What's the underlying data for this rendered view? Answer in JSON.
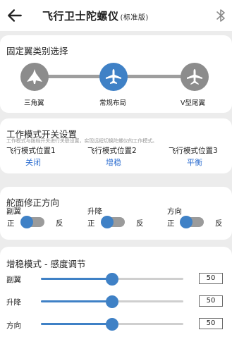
{
  "header": {
    "title": "飞行卫士陀螺仪",
    "subtitle": "(标准版)",
    "back_icon": "arrow-left-icon",
    "bluetooth_icon": "bluetooth-icon"
  },
  "wing_type": {
    "title": "固定翼类别选择",
    "options": [
      {
        "label": "三角翼",
        "icon": "delta-wing-plane-icon"
      },
      {
        "label": "常规布局",
        "icon": "conventional-plane-icon"
      },
      {
        "label": "V型尾翼",
        "icon": "v-tail-plane-icon"
      }
    ],
    "selected_index": 1
  },
  "work_mode": {
    "title": "工作模式开关设置",
    "hint": "工作模式与拨档开关进行关联设置，实现远程切换陀螺仪的工作模式。",
    "positions": [
      {
        "label": "飞行模式位置1",
        "value": "关闭"
      },
      {
        "label": "飞行模式位置2",
        "value": "增稳"
      },
      {
        "label": "飞行模式位置3",
        "value": "平衡"
      }
    ]
  },
  "servo_direction": {
    "title": "舵面修正方向",
    "forward_label": "正",
    "reverse_label": "反",
    "axes": [
      {
        "label": "副翼",
        "reversed": false
      },
      {
        "label": "升降",
        "reversed": false
      },
      {
        "label": "方向",
        "reversed": false
      }
    ]
  },
  "sensitivity": {
    "title": "增稳模式 - 感度调节",
    "max": 100,
    "sliders": [
      {
        "label": "副翼",
        "value": "50"
      },
      {
        "label": "升降",
        "value": "50"
      },
      {
        "label": "方向",
        "value": "50"
      }
    ]
  },
  "colors": {
    "accent": "#3f81c6",
    "link": "#2f6fd0",
    "inactive": "#9b9b9b"
  }
}
